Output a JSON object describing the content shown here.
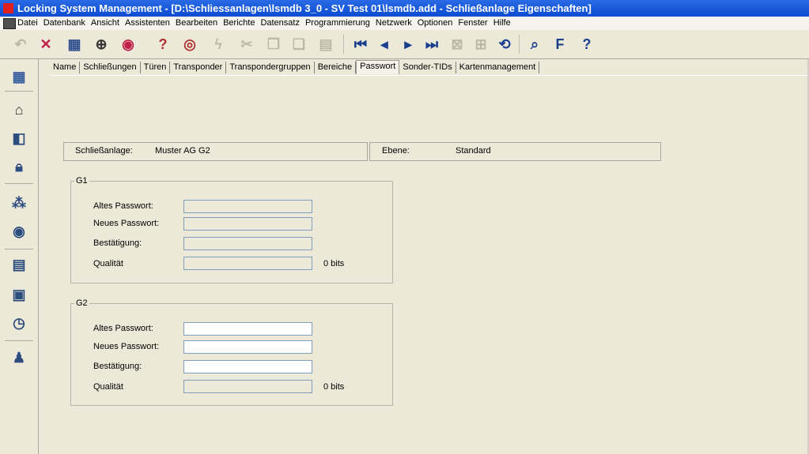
{
  "window": {
    "title": "Locking System Management - [D:\\Schliessanlagen\\lsmdb 3_0 - SV Test 01\\lsmdb.add - Schließanlage Eigenschaften]"
  },
  "menu": [
    "Datei",
    "Datenbank",
    "Ansicht",
    "Assistenten",
    "Bearbeiten",
    "Berichte",
    "Datensatz",
    "Programmierung",
    "Netzwerk",
    "Optionen",
    "Fenster",
    "Hilfe"
  ],
  "tabs": [
    "Name",
    "Schließungen",
    "Türen",
    "Transponder",
    "Transpondergruppen",
    "Bereiche",
    "Passwort",
    "Sonder-TIDs",
    "Kartenmanagement"
  ],
  "active_tab": "Passwort",
  "info": {
    "schliessanlage_label": "Schließanlage:",
    "schliessanlage_value": "Muster AG G2",
    "ebene_label": "Ebene:",
    "ebene_value": "Standard"
  },
  "g1": {
    "legend": "G1",
    "altes_label": "Altes Passwort:",
    "neues_label": "Neues Passwort:",
    "bestaetigung_label": "Bestätigung:",
    "qualitaet_label": "Qualität",
    "bits": "0 bits"
  },
  "g2": {
    "legend": "G2",
    "altes_label": "Altes Passwort:",
    "neues_label": "Neues Passwort:",
    "bestaetigung_label": "Bestätigung:",
    "qualitaet_label": "Qualität",
    "bits": "0 bits"
  },
  "toolbar_icons": [
    "undo-icon",
    "delete-icon",
    "new-lock-icon",
    "new-transponder-icon",
    "new-group-icon",
    "lock-question-icon",
    "transponder-question-icon",
    "flash-icon",
    "cut-icon",
    "copy-icon",
    "paste-icon",
    "print-icon",
    "first-record-icon",
    "prev-record-icon",
    "next-record-icon",
    "last-record-icon",
    "delete-record-icon",
    "new-record-icon",
    "refresh-icon",
    "search-icon",
    "options-icon",
    "help-icon"
  ],
  "sidebar_icons": [
    "grid-icon",
    "house-icon",
    "door-icon",
    "lock-icon",
    "group-icon",
    "transponder-icon",
    "calendar-grid-icon",
    "calendar-icon",
    "clock-icon",
    "person-icon"
  ]
}
